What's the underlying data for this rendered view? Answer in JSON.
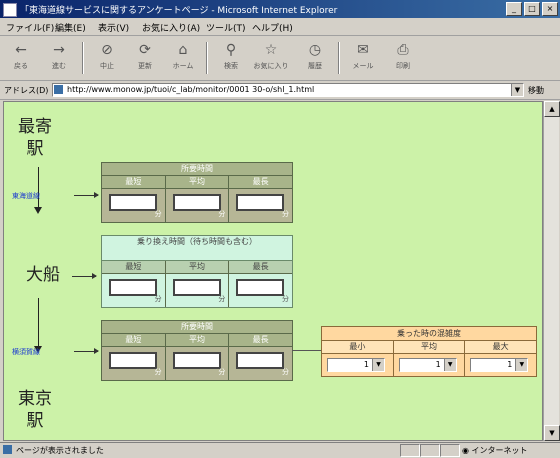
{
  "window": {
    "title": "「東海道線サービスに関するアンケートページ - Microsoft Internet Explorer",
    "min_label": "_",
    "max_label": "□",
    "close_label": "×"
  },
  "menu": [
    "ファイル(F)",
    "編集(E)",
    "表示(V)",
    "お気に入り(A)",
    "ツール(T)",
    "ヘルプ(H)"
  ],
  "toolbar": {
    "back": "戻る",
    "forward": "進む",
    "stop": "中止",
    "refresh": "更新",
    "home": "ホーム",
    "search": "検索",
    "favorites": "お気に入り",
    "history": "履歴",
    "mail": "メール",
    "print": "印刷"
  },
  "address": {
    "label": "アドレス(D)",
    "url": "http://www.monow.jp/tuoi/c_lab/monitor/0001 30-o/shl_1.html",
    "go_label": "移動"
  },
  "stations": {
    "top": "最寄駅",
    "middle": "大船",
    "bottom": "東京駅"
  },
  "route_links": {
    "top": "東海道線",
    "bottom": "横須賀線"
  },
  "table1": {
    "header": "所要時間",
    "columns": [
      "最短",
      "平均",
      "最長"
    ],
    "values": [
      "",
      "",
      ""
    ],
    "unit": "分"
  },
  "table2": {
    "header": "乗り換え時間（待ち時間も含む）",
    "columns": [
      "最短",
      "平均",
      "最長"
    ],
    "values": [
      "",
      "",
      ""
    ],
    "unit": "分"
  },
  "table3": {
    "header": "所要時間",
    "columns": [
      "最短",
      "平均",
      "最長"
    ],
    "values": [
      "",
      "",
      ""
    ],
    "unit": "分"
  },
  "crowd": {
    "header": "乗った時の混雑度",
    "columns": [
      "最小",
      "平均",
      "最大"
    ],
    "values": [
      "1",
      "1",
      "1"
    ]
  },
  "status": {
    "text": "ページが表示されました",
    "zone": "インターネット"
  },
  "colors": {
    "page_bg": "#ccf2a8",
    "table_header": "#a8b48a",
    "transfer_bg": "#d0f4e0",
    "crowd_bg": "#ffd8a0",
    "link": "#1a3ad0"
  }
}
